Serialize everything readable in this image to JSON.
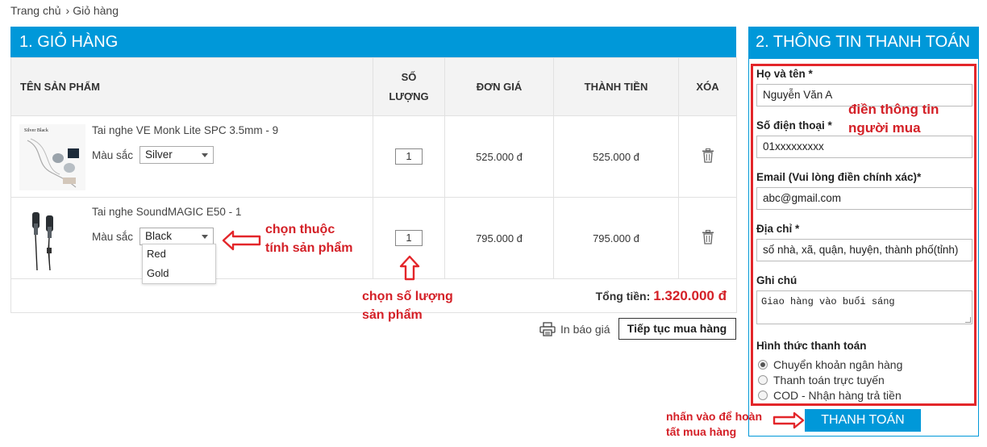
{
  "breadcrumb": {
    "home": "Trang chủ",
    "separator": "›",
    "current": "Giỏ hàng"
  },
  "cart": {
    "title": "1. GIỎ HÀNG",
    "headers": {
      "name": "TÊN SẢN PHẨM",
      "qty_line1": "SỐ",
      "qty_line2": "LƯỢNG",
      "unit_price": "ĐƠN GIÁ",
      "line_total": "THÀNH TIỀN",
      "delete": "XÓA"
    },
    "items": [
      {
        "name": "Tai nghe VE Monk Lite SPC 3.5mm - 9",
        "color_label": "Màu sắc",
        "color": "Silver",
        "qty": "1",
        "unit_price": "525.000 đ",
        "line_total": "525.000 đ",
        "thumb_text": "Silver Black"
      },
      {
        "name": "Tai nghe SoundMAGIC E50 - 1",
        "color_label": "Màu sắc",
        "color": "Black",
        "qty": "1",
        "unit_price": "795.000 đ",
        "line_total": "795.000 đ"
      }
    ],
    "dropdown_options": [
      "Red",
      "Gold"
    ],
    "total_label": "Tổng tiền:",
    "total_value": "1.320.000 đ",
    "print_label": "In báo giá",
    "continue_label": "Tiếp tục mua hàng"
  },
  "payment": {
    "title": "2. THÔNG TIN THANH TOÁN",
    "name_label": "Họ và tên *",
    "name_value": "Nguyễn Văn A",
    "phone_label": "Số điện thoại *",
    "phone_value": "01xxxxxxxxx",
    "email_label": "Email (Vui lòng điền chính xác)*",
    "email_value": "abc@gmail.com",
    "address_label": "Địa chỉ *",
    "address_value": "số nhà, xã, quận, huyện, thành phố(tỉnh)",
    "note_label": "Ghi chú",
    "note_value": "Giao hàng vào buổi sáng",
    "method_label": "Hình thức thanh toán",
    "methods": [
      "Chuyển khoản ngân hàng",
      "Thanh toán trực tuyến",
      "COD - Nhận hàng trả tiền"
    ],
    "selected_method_index": 0,
    "submit_label": "THANH TOÁN"
  },
  "annotations": {
    "fill_info_1": "điền thông tin",
    "fill_info_2": "người mua",
    "choose_attr_1": "chọn thuộc",
    "choose_attr_2": "tính sản phẩm",
    "choose_qty_1": "chọn số lượng",
    "choose_qty_2": "sản phẩm",
    "click_finish_1": "nhấn vào để hoàn",
    "click_finish_2": "tất mua hàng"
  },
  "colors": {
    "brand_blue": "#0098d9",
    "accent_red": "#d42027",
    "annotation_red": "#e3262a"
  }
}
